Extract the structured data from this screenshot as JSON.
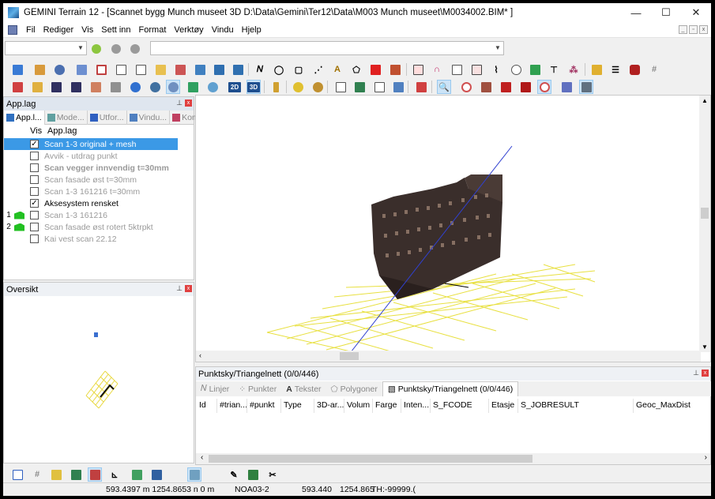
{
  "window": {
    "title": "GEMINI Terrain 12 - [Scannet bygg Munch museet  3D  D:\\Data\\Gemini\\Ter12\\Data\\M003 Munch museet\\M0034002.BIM* ]",
    "minimize": "—",
    "maximize": "☐",
    "close": "✕"
  },
  "menu": [
    "Fil",
    "Rediger",
    "Vis",
    "Sett inn",
    "Format",
    "Verktøy",
    "Vindu",
    "Hjelp"
  ],
  "applag_panel": {
    "title": "App.lag",
    "tabs": [
      "App.l...",
      "Mode...",
      "Utfor...",
      "Vindu...",
      "Kom..."
    ],
    "col_vis": "Vis",
    "col_name": "App.lag",
    "layers": [
      {
        "num": "",
        "flag": false,
        "checked": true,
        "name": "Scan 1-3 original + mesh",
        "style": "sel"
      },
      {
        "num": "",
        "flag": false,
        "checked": false,
        "name": "Avvik - utdrag punkt",
        "style": "gray"
      },
      {
        "num": "",
        "flag": false,
        "checked": false,
        "name": "Scan vegger innvendig t=30mm",
        "style": "boldg"
      },
      {
        "num": "",
        "flag": false,
        "checked": false,
        "name": "Scan fasade øst t=30mm",
        "style": "gray"
      },
      {
        "num": "",
        "flag": false,
        "checked": false,
        "name": "Scan 1-3 161216 t=30mm",
        "style": "gray"
      },
      {
        "num": "",
        "flag": false,
        "checked": true,
        "name": "Aksesystem rensket",
        "style": "normal"
      },
      {
        "num": "1",
        "flag": true,
        "checked": false,
        "name": "Scan 1-3 161216",
        "style": "gray"
      },
      {
        "num": "2",
        "flag": true,
        "checked": false,
        "name": "Scan fasade øst rotert 5ktrpkt",
        "style": "gray"
      },
      {
        "num": "",
        "flag": false,
        "checked": false,
        "name": "Kai vest scan 22.12",
        "style": "gray"
      }
    ]
  },
  "oversikt_panel": {
    "title": "Oversikt"
  },
  "bottom_panel": {
    "title": "Punktsky/Triangelnett (0/0/446)",
    "tabs": [
      "Linjer",
      "Punkter",
      "Tekster",
      "Polygoner",
      "Punktsky/Triangelnett (0/0/446)"
    ],
    "columns": [
      "Id",
      "#trian...",
      "#punkt",
      "Type",
      "3D-ar...",
      "Volum",
      "Farge",
      "Inten...",
      "S_FCODE",
      "Etasje",
      "S_JOBRESULT",
      "Geoc_MaxDist"
    ]
  },
  "status": {
    "coords": "593.4397 m  1254.8653 n 0 m",
    "system": "NOA03-2",
    "x": "593.440",
    "y": "1254.865",
    "th": "TH:-99999.("
  },
  "colors": {
    "accent": "#3b99e6",
    "grid": "#e8e040",
    "building": "#3a2e2b"
  },
  "icons": [
    "open-icon",
    "save-icon",
    "print-icon",
    "line-icon",
    "circle-icon",
    "rectangle-icon",
    "text-icon",
    "polygon-icon",
    "zoom-icon",
    "eye-icon",
    "3d-icon",
    "2d-icon"
  ]
}
